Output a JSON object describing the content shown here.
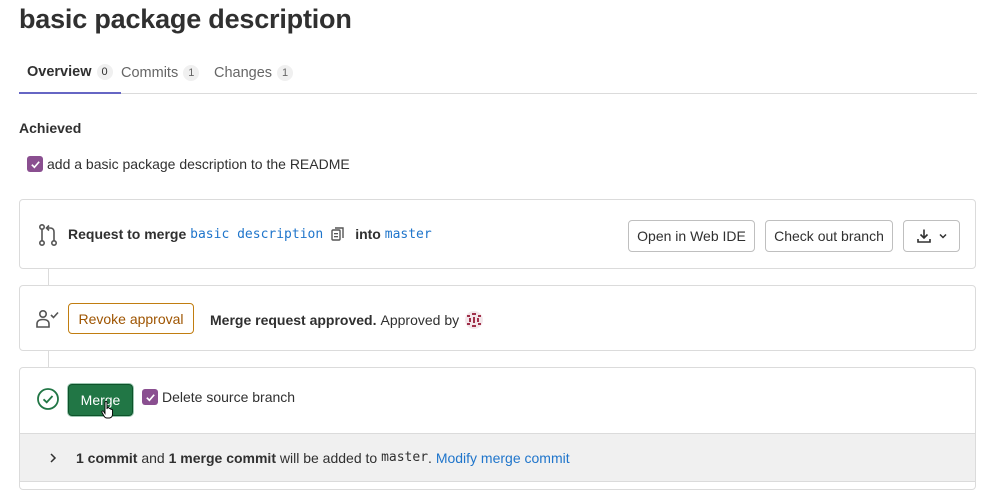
{
  "page": {
    "title": "basic package description"
  },
  "tabs": [
    {
      "label": "Overview",
      "count": "0",
      "active": true
    },
    {
      "label": "Commits",
      "count": "1",
      "active": false
    },
    {
      "label": "Changes",
      "count": "1",
      "active": false
    }
  ],
  "achieved": {
    "heading": "Achieved",
    "task": "add a basic package description to the README",
    "checked": true
  },
  "merge_info": {
    "prefix": "Request to merge",
    "source_branch": "basic description",
    "into": "into",
    "target_branch": "master",
    "buttons": {
      "web_ide": "Open in Web IDE",
      "checkout": "Check out branch"
    }
  },
  "approval": {
    "revoke_label": "Revoke approval",
    "status": "Merge request approved.",
    "approved_by": "Approved by"
  },
  "merge": {
    "button_label": "Merge",
    "delete_source_label": "Delete source branch",
    "delete_source_checked": true,
    "commits_count": "1 commit",
    "and": "and",
    "merge_commit": "1 merge commit",
    "added_to": "will be added to",
    "branch": "master",
    "period": ".",
    "modify_link": "Modify merge commit"
  },
  "colors": {
    "primary_text": "#303030",
    "link": "#1f75cb",
    "merge_green": "#217645",
    "checkbox_purple": "#8a4f90",
    "revoke_orange": "#9e5400",
    "tab_underline": "#6666c4"
  }
}
